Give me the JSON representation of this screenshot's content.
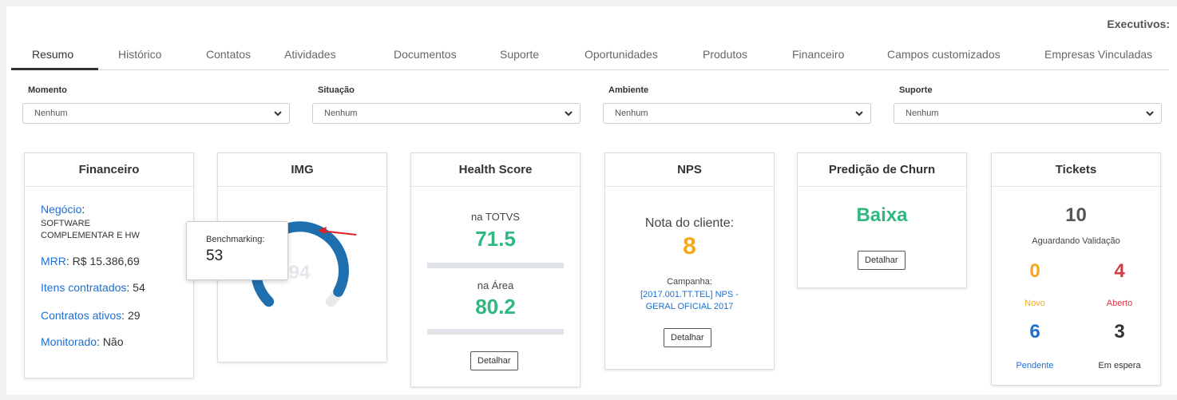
{
  "header": {
    "executivos_label": "Executivos:"
  },
  "tabs": [
    {
      "label": "Resumo"
    },
    {
      "label": "Histórico"
    },
    {
      "label": "Contatos"
    },
    {
      "label": "Atividades"
    },
    {
      "label": "Documentos"
    },
    {
      "label": "Suporte"
    },
    {
      "label": "Oportunidades"
    },
    {
      "label": "Produtos"
    },
    {
      "label": "Financeiro"
    },
    {
      "label": "Campos customizados"
    },
    {
      "label": "Empresas Vinculadas"
    }
  ],
  "filters": [
    {
      "label": "Momento",
      "value": "Nenhum"
    },
    {
      "label": "Situação",
      "value": "Nenhum"
    },
    {
      "label": "Ambiente",
      "value": "Nenhum"
    },
    {
      "label": "Suporte",
      "value": "Nenhum"
    }
  ],
  "financeiro": {
    "title": "Financeiro",
    "negocio_label": "Negócio",
    "negocio_line1": "SOFTWARE",
    "negocio_line2": "COMPLEMENTAR E HW",
    "mrr_label": "MRR",
    "mrr_value": ": R$ 15.386,69",
    "itens_label": "Itens contratados",
    "itens_value": ": 54",
    "contratos_label": "Contratos ativos",
    "contratos_value": ": 29",
    "monitorado_label": "Monitorado",
    "monitorado_value": ": Não"
  },
  "img": {
    "title": "IMG",
    "value": "94",
    "benchmark_label": "Benchmarking:",
    "benchmark_value": "53",
    "level_fraction": 0.94
  },
  "health": {
    "title": "Health Score",
    "totvs_label": "na TOTVS",
    "totvs_value": "71.5",
    "area_label": "na Área",
    "area_value": "80.2",
    "button": "Detalhar"
  },
  "nps": {
    "title": "NPS",
    "nota_label": "Nota do cliente:",
    "nota_value": "8",
    "campanha_label": "Campanha:",
    "campanha_line1": "[2017.001.TT.TEL] NPS -",
    "campanha_line2": "GERAL OFICIAL 2017",
    "button": "Detalhar"
  },
  "churn": {
    "title": "Predição de Churn",
    "value": "Baixa",
    "button": "Detalhar"
  },
  "tickets": {
    "title": "Tickets",
    "aguardando_value": "10",
    "aguardando_label": "Aguardando Validação",
    "novo_value": "0",
    "novo_label": "Novo",
    "aberto_value": "4",
    "aberto_label": "Aberto",
    "pendente_value": "6",
    "pendente_label": "Pendente",
    "espera_value": "3",
    "espera_label": "Em espera"
  },
  "colors": {
    "link_blue": "#1e6fd0",
    "green": "#2fb87f",
    "orange": "#f5a81c",
    "red": "#d63a44",
    "gauge_blue": "#1e6fb0",
    "arrow_red": "#e02020"
  }
}
